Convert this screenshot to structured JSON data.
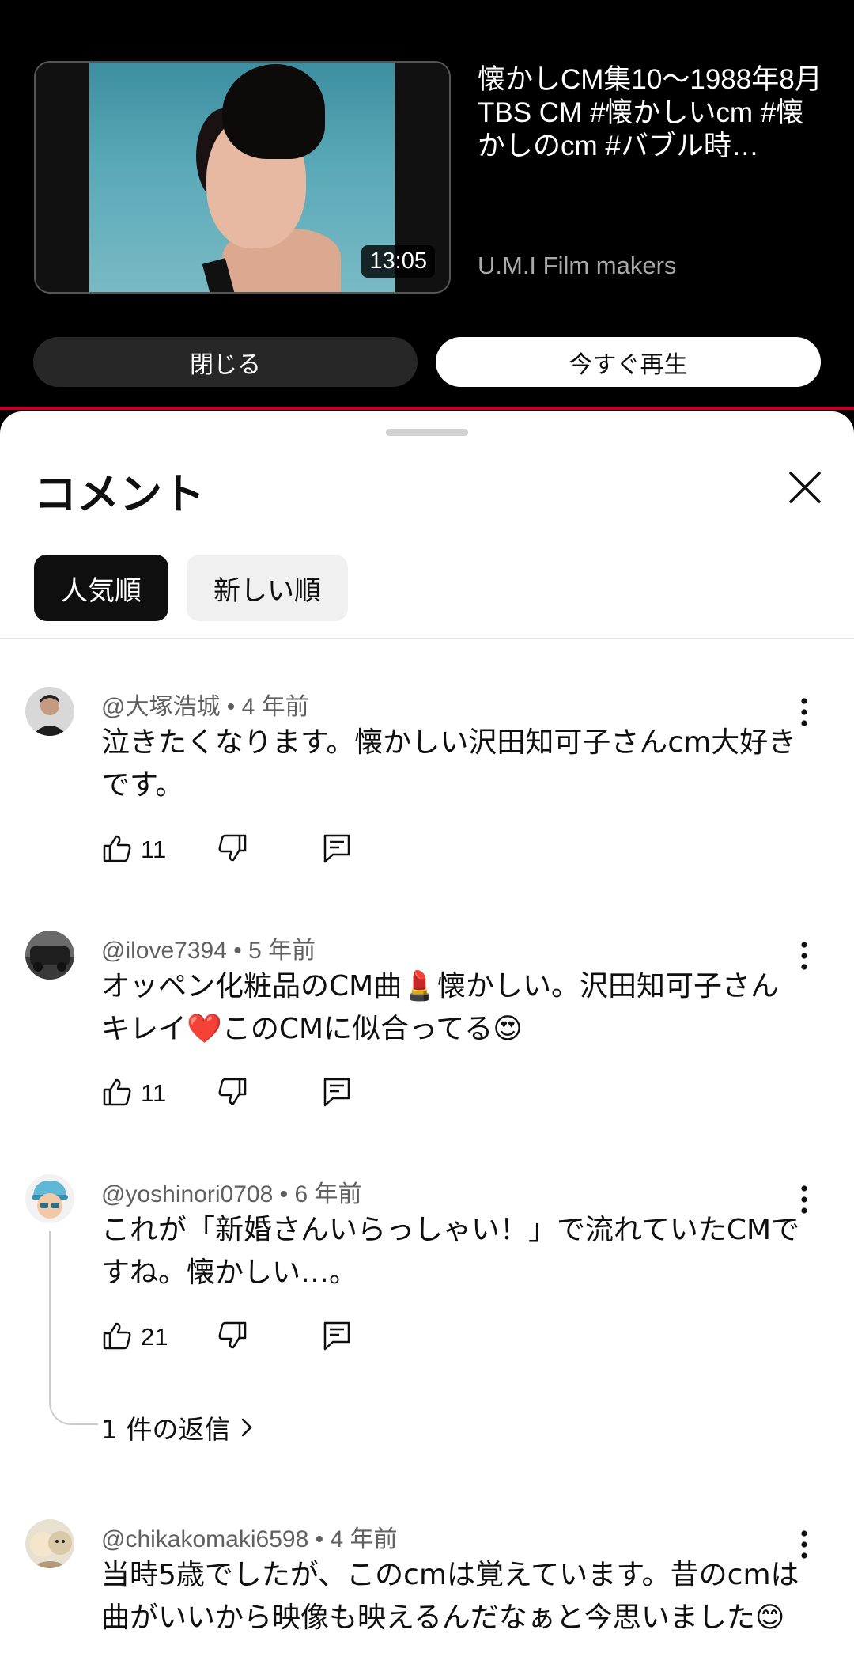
{
  "up_next": {
    "duration": "13:05",
    "title": "懐かしCM集10〜1988年8月 TBS CM #懐かしいcm #懐かしのcm #バブル時…",
    "channel": "U.M.I Film makers",
    "close_label": "閉じる",
    "play_now_label": "今すぐ再生"
  },
  "comments_sheet": {
    "title": "コメント",
    "chips": [
      "人気順",
      "新しい順"
    ],
    "comments": [
      {
        "author": "@大塚浩城",
        "age": "4 年前",
        "text": "泣きたくなります。懐かしい沢田知可子さんcm大好きです。",
        "likes": "11",
        "avatar_color": "#2b2b2b"
      },
      {
        "author": "@ilove7394",
        "age": "5 年前",
        "text": "オッペン化粧品のCM曲💄懐かしい。沢田知可子さんキレイ❤️このCMに似合ってる😍",
        "likes": "11",
        "avatar_color": "#4a4a4a"
      },
      {
        "author": "@yoshinori0708",
        "age": "6 年前",
        "text": "これが「新婚さんいらっしゃい！」で流れていたCMですね。懐かしい…。",
        "likes": "21",
        "avatar_color": "#5fb7d6",
        "replies_label": "1 件の返信"
      },
      {
        "author": "@chikakomaki6598",
        "age": "4 年前",
        "text": "当時5歳でしたが、このcmは覚えています。昔のcmは曲がいいから映像も映えるんだなぁと今思いました😊",
        "avatar_color": "#d9c9a8"
      }
    ]
  },
  "colors": {
    "accent_red": "#c4002b",
    "chip_active_bg": "#0f0f0f",
    "chip_bg": "#f0f0f0"
  }
}
